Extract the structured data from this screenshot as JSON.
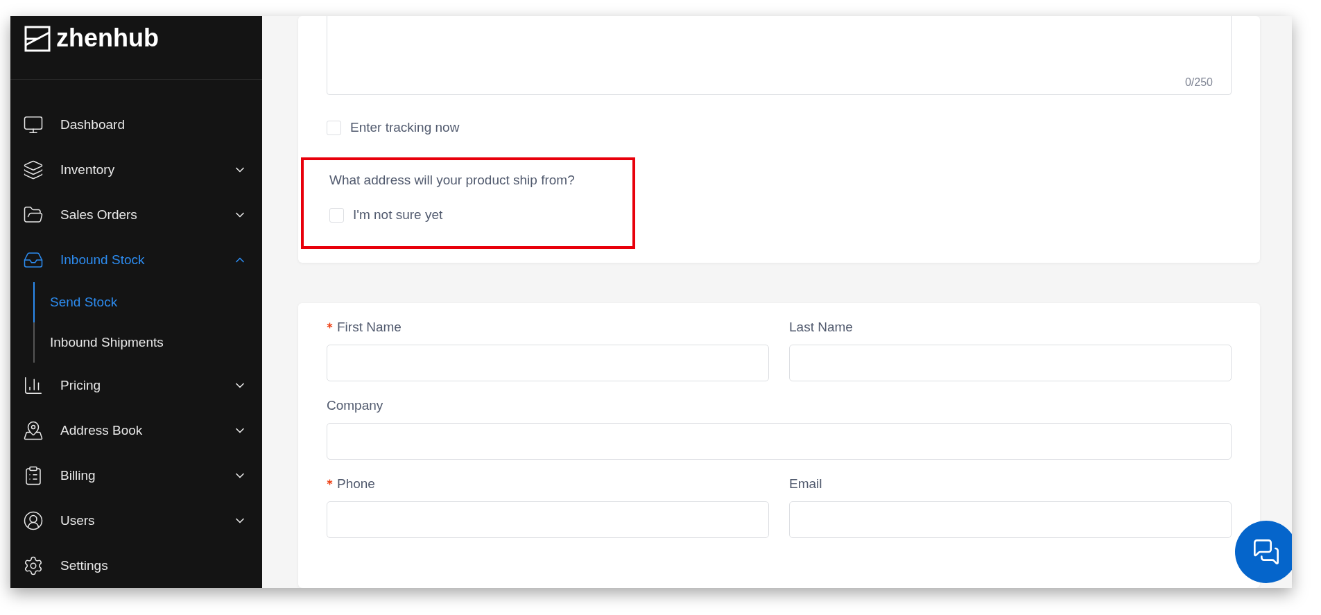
{
  "sidebar": {
    "logo": "zhenhub",
    "items": [
      {
        "label": "Dashboard",
        "selected": false,
        "expandable": false
      },
      {
        "label": "Inventory",
        "selected": false,
        "expandable": true,
        "expanded": false
      },
      {
        "label": "Sales Orders",
        "selected": false,
        "expandable": true,
        "expanded": false
      },
      {
        "label": "Inbound Stock",
        "selected": true,
        "expandable": true,
        "expanded": true,
        "children": [
          {
            "label": "Send Stock",
            "selected": true
          },
          {
            "label": "Inbound Shipments",
            "selected": false
          }
        ]
      },
      {
        "label": "Pricing",
        "selected": false,
        "expandable": true,
        "expanded": false
      },
      {
        "label": "Address Book",
        "selected": false,
        "expandable": true,
        "expanded": false
      },
      {
        "label": "Billing",
        "selected": false,
        "expandable": true,
        "expanded": false
      },
      {
        "label": "Users",
        "selected": false,
        "expandable": true,
        "expanded": false
      },
      {
        "label": "Settings",
        "selected": false,
        "expandable": false
      }
    ]
  },
  "shipment_card": {
    "notes_counter": "0/250",
    "tracking_checkbox": {
      "label": "Enter tracking now",
      "checked": false
    },
    "address_question": "What address will your product ship from?",
    "not_sure_checkbox": {
      "label": "I'm not sure yet",
      "checked": false
    },
    "highlighted": true
  },
  "address_card": {
    "rows": [
      [
        {
          "label": "First Name",
          "required": true
        },
        {
          "label": "Last Name",
          "required": false
        }
      ],
      [
        {
          "label": "Company",
          "required": false
        }
      ],
      [
        {
          "label": "Phone",
          "required": true
        },
        {
          "label": "Email",
          "required": false
        }
      ]
    ]
  }
}
